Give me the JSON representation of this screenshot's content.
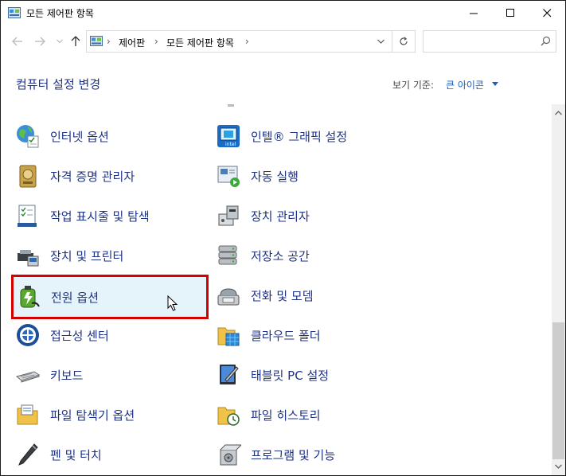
{
  "window": {
    "title": "모든 제어판 항목",
    "controls": [
      "minimize-icon",
      "maximize-icon",
      "close-icon"
    ]
  },
  "address": {
    "crumbs": [
      "제어판",
      "모든 제어판 항목"
    ],
    "separator": "›",
    "search_placeholder": ""
  },
  "header": {
    "title": "컴퓨터 설정 변경",
    "view_by_label": "보기 기준:",
    "view_by_value": "큰 아이콘"
  },
  "items": [
    {
      "label": "인터넷 옵션",
      "icon": "internet-options-icon"
    },
    {
      "label": "인텔® 그래픽 설정",
      "icon": "intel-graphics-icon"
    },
    {
      "label": "자격 증명 관리자",
      "icon": "credential-manager-icon"
    },
    {
      "label": "자동 실행",
      "icon": "autoplay-icon"
    },
    {
      "label": "작업 표시줄 및 탐색",
      "icon": "taskbar-icon"
    },
    {
      "label": "장치 관리자",
      "icon": "device-manager-icon"
    },
    {
      "label": "장치 및 프린터",
      "icon": "devices-printers-icon"
    },
    {
      "label": "저장소 공간",
      "icon": "storage-spaces-icon"
    },
    {
      "label": "전원 옵션",
      "icon": "power-options-icon",
      "highlighted": true
    },
    {
      "label": "전화 및 모뎀",
      "icon": "phone-modem-icon"
    },
    {
      "label": "접근성 센터",
      "icon": "ease-of-access-icon"
    },
    {
      "label": "클라우드 폴더",
      "icon": "cloud-folder-icon"
    },
    {
      "label": "키보드",
      "icon": "keyboard-icon"
    },
    {
      "label": "태블릿 PC 설정",
      "icon": "tablet-pc-icon"
    },
    {
      "label": "파일 탐색기 옵션",
      "icon": "file-explorer-options-icon"
    },
    {
      "label": "파일 히스토리",
      "icon": "file-history-icon"
    },
    {
      "label": "펜 및 터치",
      "icon": "pen-touch-icon"
    },
    {
      "label": "프로그램 및 기능",
      "icon": "programs-features-icon"
    }
  ],
  "colors": {
    "link": "#1e3287",
    "highlight_border": "#d50000",
    "highlight_bg": "#e5f3fb",
    "view_by_value": "#1e5fb4"
  }
}
